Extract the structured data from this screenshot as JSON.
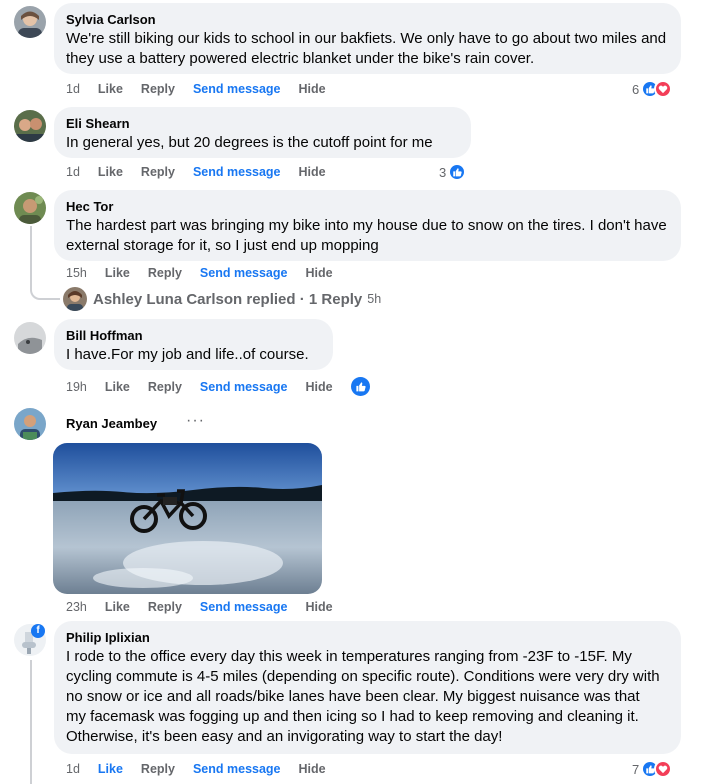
{
  "comments": [
    {
      "author": "Sylvia Carlson",
      "text": "We're still biking our kids to school in our bakfiets. We only have to go about two miles and they use a battery powered electric blanket under the bike's rain cover.",
      "time": "1d",
      "like": "Like",
      "reply": "Reply",
      "send": "Send message",
      "hide": "Hide",
      "reaction_count": "6"
    },
    {
      "author": "Eli Shearn",
      "text": "In general yes, but 20 degrees is the cutoff point for me",
      "time": "1d",
      "like": "Like",
      "reply": "Reply",
      "send": "Send message",
      "hide": "Hide",
      "reaction_count": "3"
    },
    {
      "author": "Hec Tor",
      "text": "The hardest part was bringing my bike into my house due to snow on the tires. I don't have external storage for it, so I just end up mopping",
      "time": "15h",
      "like": "Like",
      "reply": "Reply",
      "send": "Send message",
      "hide": "Hide",
      "replies": {
        "label": "Ashley Luna Carlson replied · 1 Reply",
        "time": "5h"
      }
    },
    {
      "author": "Bill Hoffman",
      "text": "I have.For my job and life..of course.",
      "time": "19h",
      "like": "Like",
      "reply": "Reply",
      "send": "Send message",
      "hide": "Hide"
    },
    {
      "author": "Ryan Jeambey",
      "more": "···",
      "time": "23h",
      "like": "Like",
      "reply": "Reply",
      "send": "Send message",
      "hide": "Hide"
    },
    {
      "author": "Philip Iplixian",
      "text": "I rode to the office every day this week in temperatures ranging from -23F to -15F. My cycling commute is 4-5 miles (depending on specific route). Conditions were very dry with no snow or ice and all roads/bike lanes have been clear. My biggest nuisance was that my facemask was fogging up and then icing so I had to keep removing and cleaning it. Otherwise, it's been easy and an invigorating way to start the day!",
      "time": "1d",
      "like": "Like",
      "reply": "Reply",
      "send": "Send message",
      "hide": "Hide",
      "reaction_count": "7"
    }
  ],
  "colors": {
    "bubble": "#f0f2f5",
    "link": "#1877f2",
    "muted": "#65676b",
    "love": "#f33e58"
  },
  "icons": [
    "like-thumb-icon",
    "love-heart-icon",
    "more-dots-icon",
    "facebook-badge-icon"
  ]
}
